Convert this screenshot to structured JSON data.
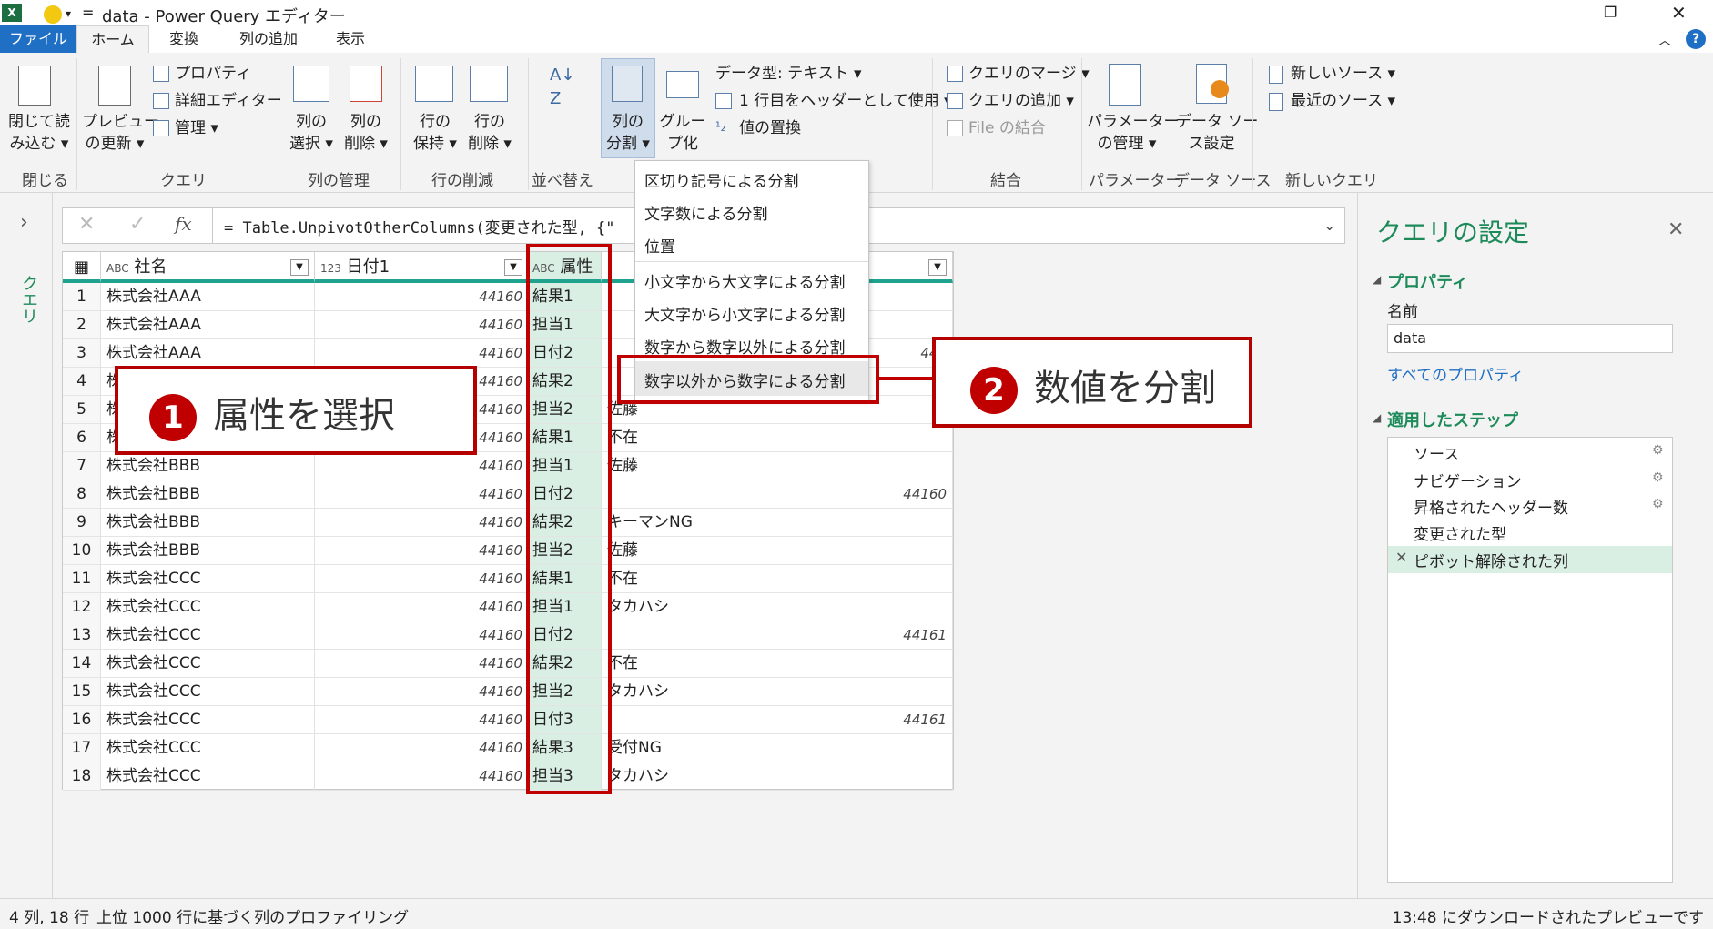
{
  "window": {
    "title": "data - Power Query エディター"
  },
  "tabs": [
    "ファイル",
    "ホーム",
    "変換",
    "列の追加",
    "表示"
  ],
  "ribbon": {
    "close_load": "閉じて読\nみ込む ▾",
    "group_close": "閉じる",
    "preview": "プレビュー\nの更新 ▾",
    "properties": "プロパティ",
    "advanced_editor": "詳細エディター",
    "manage": "管理 ▾",
    "group_query": "クエリ",
    "choose_columns": "列の\n選択 ▾",
    "remove_columns": "列の\n削除 ▾",
    "group_manage_cols": "列の管理",
    "keep_rows": "行の\n保持 ▾",
    "remove_rows": "行の\n削除 ▾",
    "group_reduce_rows": "行の削減",
    "group_sort": "並べ替え",
    "split_column": "列の\n分割 ▾",
    "group_by": "グルー\nプ化",
    "data_type": "データ型: テキスト ▾",
    "use_first_row": "1 行目をヘッダーとして使用 ▾",
    "replace_values": "値の置換",
    "merge_queries": "クエリのマージ ▾",
    "append_queries": "クエリの追加 ▾",
    "combine_files": "File の結合",
    "group_combine": "結合",
    "manage_params": "パラメーター\nの管理 ▾",
    "group_params": "パラメーター",
    "data_source_settings": "データ ソー\nス設定",
    "group_data_source": "データ ソース",
    "new_source": "新しいソース ▾",
    "recent_sources": "最近のソース ▾",
    "group_new_query": "新しいクエリ"
  },
  "split_menu": [
    "区切り記号による分割",
    "文字数による分割",
    "位置",
    "小文字から大文字による分割",
    "大文字から小文字による分割",
    "数字から数字以外による分割",
    "数字以外から数字による分割"
  ],
  "formula": "= Table.UnpivotOtherColumns(変更された型, {\"",
  "left_pane_label": "クエリ",
  "columns": [
    {
      "type": "ABC",
      "name": "社名"
    },
    {
      "type": "123",
      "name": "日付1"
    },
    {
      "type": "ABC",
      "name": "属性"
    },
    {
      "type": "",
      "name": ""
    }
  ],
  "rows": [
    {
      "n": "1",
      "company": "株式会社AAA",
      "date": "44160",
      "attr": "結果1",
      "value": ""
    },
    {
      "n": "2",
      "company": "株式会社AAA",
      "date": "44160",
      "attr": "担当1",
      "value": ""
    },
    {
      "n": "3",
      "company": "株式会社AAA",
      "date": "44160",
      "attr": "日付2",
      "value": "441"
    },
    {
      "n": "4",
      "company": "株",
      "date": "44160",
      "attr": "結果2",
      "value": ""
    },
    {
      "n": "5",
      "company": "株",
      "date": "44160",
      "attr": "担当2",
      "value": "佐藤"
    },
    {
      "n": "6",
      "company": "株",
      "date": "44160",
      "attr": "結果1",
      "value": "不在"
    },
    {
      "n": "7",
      "company": "株式会社BBB",
      "date": "44160",
      "attr": "担当1",
      "value": "佐藤"
    },
    {
      "n": "8",
      "company": "株式会社BBB",
      "date": "44160",
      "attr": "日付2",
      "value": "44160"
    },
    {
      "n": "9",
      "company": "株式会社BBB",
      "date": "44160",
      "attr": "結果2",
      "value": "キーマンNG"
    },
    {
      "n": "10",
      "company": "株式会社BBB",
      "date": "44160",
      "attr": "担当2",
      "value": "佐藤"
    },
    {
      "n": "11",
      "company": "株式会社CCC",
      "date": "44160",
      "attr": "結果1",
      "value": "不在"
    },
    {
      "n": "12",
      "company": "株式会社CCC",
      "date": "44160",
      "attr": "担当1",
      "value": "タカハシ"
    },
    {
      "n": "13",
      "company": "株式会社CCC",
      "date": "44160",
      "attr": "日付2",
      "value": "44161"
    },
    {
      "n": "14",
      "company": "株式会社CCC",
      "date": "44160",
      "attr": "結果2",
      "value": "不在"
    },
    {
      "n": "15",
      "company": "株式会社CCC",
      "date": "44160",
      "attr": "担当2",
      "value": "タカハシ"
    },
    {
      "n": "16",
      "company": "株式会社CCC",
      "date": "44160",
      "attr": "日付3",
      "value": "44161"
    },
    {
      "n": "17",
      "company": "株式会社CCC",
      "date": "44160",
      "attr": "結果3",
      "value": "受付NG"
    },
    {
      "n": "18",
      "company": "株式会社CCC",
      "date": "44160",
      "attr": "担当3",
      "value": "タカハシ"
    }
  ],
  "settings": {
    "title": "クエリの設定",
    "properties": "プロパティ",
    "name_label": "名前",
    "name_value": "data",
    "all_properties": "すべてのプロパティ",
    "applied_steps": "適用したステップ",
    "steps": [
      "ソース",
      "ナビゲーション",
      "昇格されたヘッダー数",
      "変更された型",
      "ピボット解除された列"
    ]
  },
  "status": {
    "left1": "4 列, 18 行",
    "left2": "上位 1000 行に基づく列のプロファイリング",
    "right": "13:48 にダウンロードされたプレビューです"
  },
  "annotations": {
    "a1_num": "1",
    "a1_text": "属性を選択",
    "a2_num": "2",
    "a2_text": "数値を分割"
  }
}
